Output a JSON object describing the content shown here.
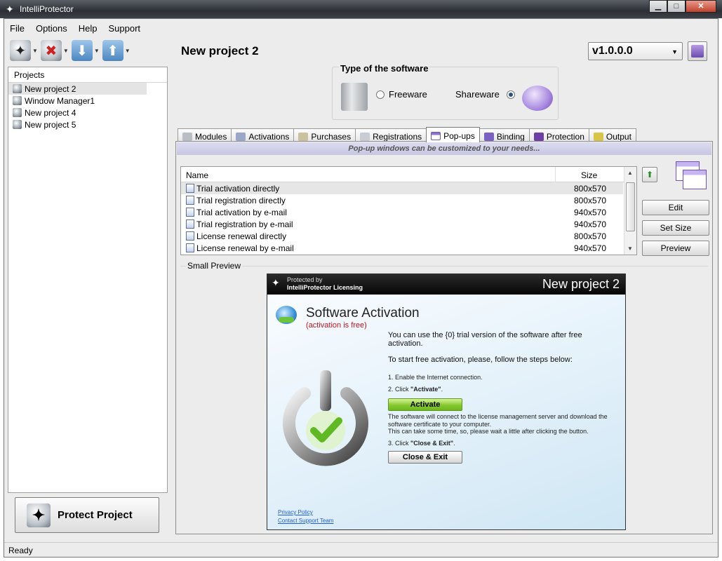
{
  "window": {
    "title": "IntelliProtector",
    "min": "▁",
    "max": "□",
    "close": "✕"
  },
  "menu": [
    "File",
    "Options",
    "Help",
    "Support"
  ],
  "toolbar": {
    "icons": [
      "shield-icon",
      "remove-shield-icon",
      "box-in-icon",
      "box-out-icon"
    ]
  },
  "projects": {
    "header": "Projects",
    "items": [
      "New project 2",
      "Window Manager1",
      "New project 4",
      "New project 5"
    ],
    "selected_index": 0
  },
  "protect_button": "Protect Project",
  "status": "Ready",
  "project_title": "New project 2",
  "version": "v1.0.0.0",
  "software_type": {
    "legend": "Type of the software",
    "freeware": "Freeware",
    "shareware": "Shareware",
    "selected": "Shareware"
  },
  "tabs": [
    "Modules",
    "Activations",
    "Purchases",
    "Registrations",
    "Pop-ups",
    "Binding",
    "Protection",
    "Output"
  ],
  "active_tab": "Pop-ups",
  "popups": {
    "banner": "Pop-up windows can be customized to your needs...",
    "columns": {
      "name": "Name",
      "size": "Size"
    },
    "rows": [
      {
        "name": "Trial activation directly",
        "size": "800x570"
      },
      {
        "name": "Trial registration directly",
        "size": "800x570"
      },
      {
        "name": "Trial activation by e-mail",
        "size": "940x570"
      },
      {
        "name": "Trial registration by e-mail",
        "size": "940x570"
      },
      {
        "name": "License renewal directly",
        "size": "800x570"
      },
      {
        "name": "License renewal by e-mail",
        "size": "940x570"
      }
    ],
    "selected_row": 0,
    "buttons": {
      "edit": "Edit",
      "set_size": "Set Size",
      "preview": "Preview"
    },
    "small_preview_label": "Small Preview"
  },
  "preview": {
    "protected_by": "Protected by",
    "licensing": "IntelliProtector Licensing",
    "project": "New project 2",
    "title": "Software Activation",
    "subtitle": "(activation is free)",
    "text1": "You can use the {0} trial version of the software after free activation.",
    "text2": "To start free activation, please, follow the steps below:",
    "step1": "1. Enable the Internet connection.",
    "step2_prefix": "2. Click ",
    "step2_bold": "\"Activate\"",
    "step2_suffix": ".",
    "activate_btn": "Activate",
    "info1": "The software will connect to the license management server and download the software certificate to your computer.",
    "info2": "This can take some time, so, please wait a little after clicking the button.",
    "step3_prefix": "3. Click ",
    "step3_bold": "\"Close & Exit\"",
    "step3_suffix": ".",
    "close_btn": "Close & Exit",
    "privacy": "Privacy Policy",
    "support": "Contact Support Team"
  }
}
